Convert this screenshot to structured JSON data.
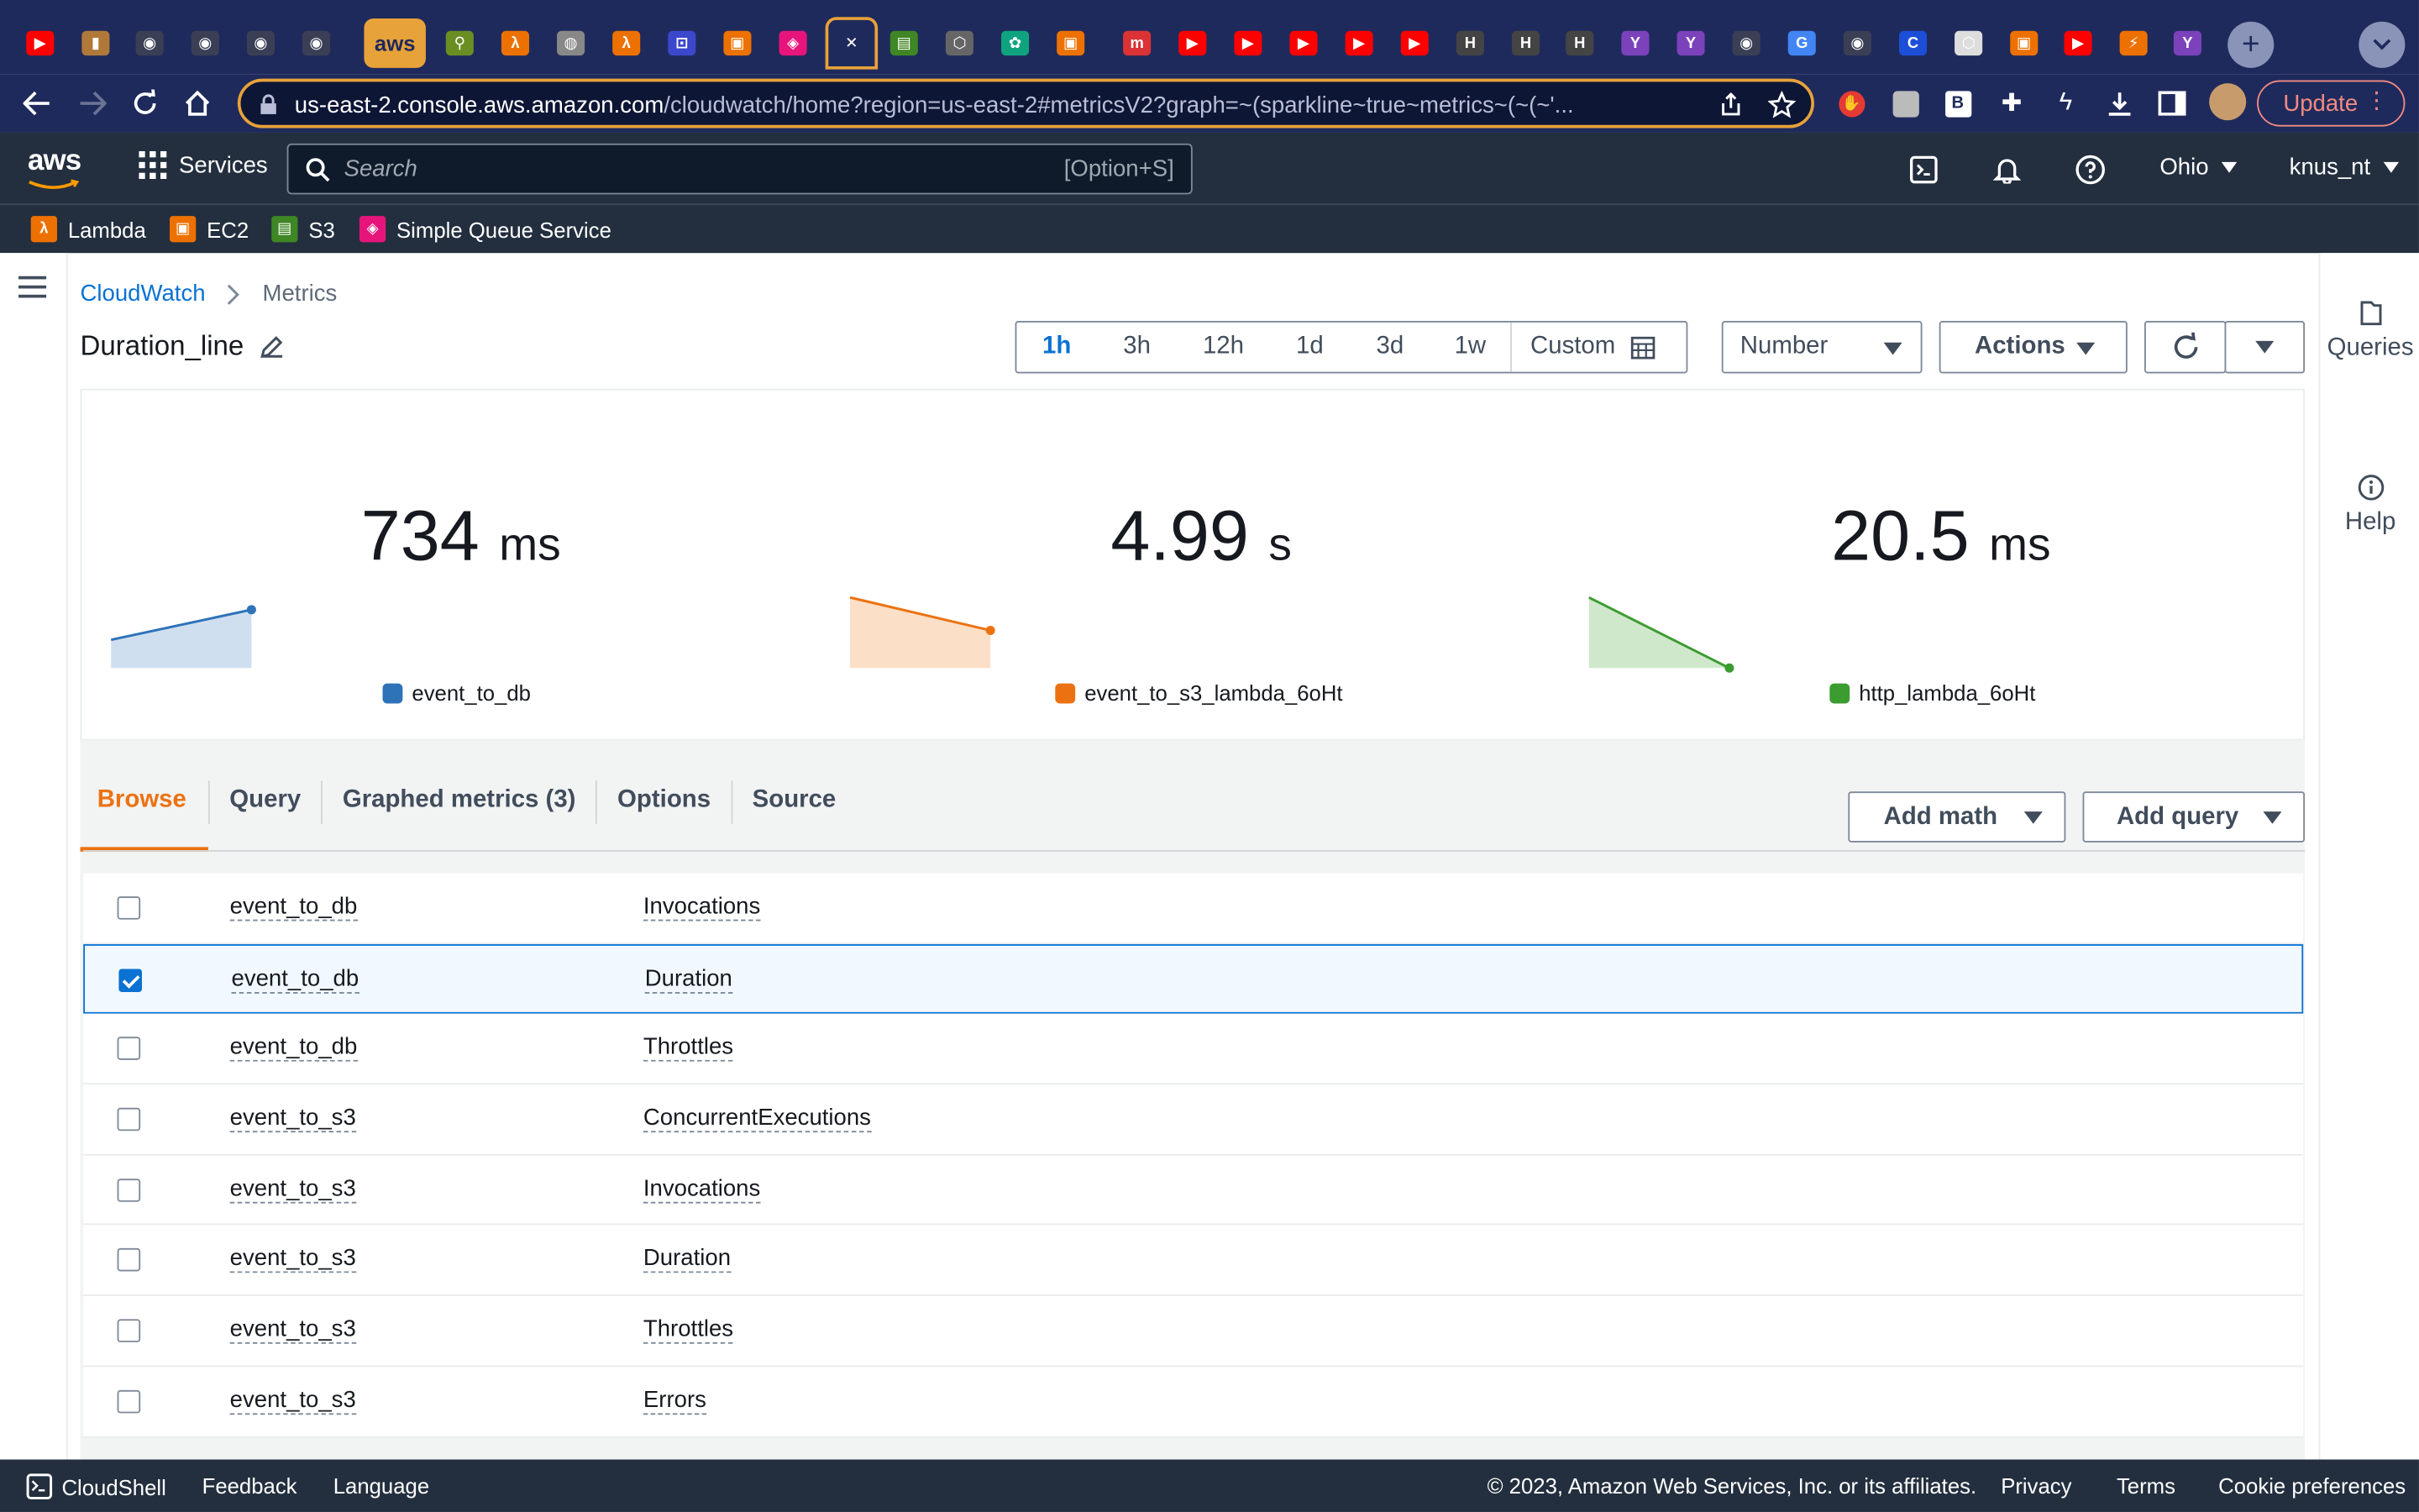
{
  "browser": {
    "tabs": [
      {
        "icon": "youtube-icon",
        "color": "#ff0000",
        "glyph": "▶"
      },
      {
        "icon": "folder-icon",
        "color": "#b0793a",
        "glyph": "▮"
      },
      {
        "icon": "github-icon",
        "color": "#3a3f55",
        "glyph": "◉"
      },
      {
        "icon": "github-icon",
        "color": "#3a3f55",
        "glyph": "◉"
      },
      {
        "icon": "github-icon",
        "color": "#3a3f55",
        "glyph": "◉"
      },
      {
        "icon": "github-icon",
        "color": "#3a3f55",
        "glyph": "◉"
      },
      {
        "icon": "aws-icon",
        "color": "#e8a23a",
        "glyph": "aws"
      },
      {
        "icon": "tool-icon",
        "color": "#6b8e23",
        "glyph": "⚲"
      },
      {
        "icon": "lambda-icon",
        "color": "#ed7100",
        "glyph": "λ"
      },
      {
        "icon": "globe-icon",
        "color": "#888",
        "glyph": "◍"
      },
      {
        "icon": "lambda-icon",
        "color": "#ed7100",
        "glyph": "λ"
      },
      {
        "icon": "cloudwatch-icon",
        "color": "#3b48cc",
        "glyph": "⊡"
      },
      {
        "icon": "box-icon",
        "color": "#ed7100",
        "glyph": "▣"
      },
      {
        "icon": "sqs-icon",
        "color": "#e7157b",
        "glyph": "◈"
      },
      {
        "icon": "close-icon",
        "color": "#1f2a5c",
        "glyph": "✕"
      },
      {
        "icon": "s3-icon",
        "color": "#3f8624",
        "glyph": "▤"
      },
      {
        "icon": "cube-icon",
        "color": "#666",
        "glyph": "⬡"
      },
      {
        "icon": "openai-icon",
        "color": "#10a37f",
        "glyph": "✿"
      },
      {
        "icon": "box-icon",
        "color": "#ed7100",
        "glyph": "▣"
      },
      {
        "icon": "m-icon",
        "color": "#db3236",
        "glyph": "m"
      },
      {
        "icon": "youtube-icon",
        "color": "#ff0000",
        "glyph": "▶"
      },
      {
        "icon": "youtube-icon",
        "color": "#ff0000",
        "glyph": "▶"
      },
      {
        "icon": "youtube-icon",
        "color": "#ff0000",
        "glyph": "▶"
      },
      {
        "icon": "youtube-icon",
        "color": "#ff0000",
        "glyph": "▶"
      },
      {
        "icon": "youtube-icon",
        "color": "#ff0000",
        "glyph": "▶"
      },
      {
        "icon": "hashicorp-icon",
        "color": "#444",
        "glyph": "H"
      },
      {
        "icon": "hashicorp-icon",
        "color": "#444",
        "glyph": "H"
      },
      {
        "icon": "hashicorp-icon",
        "color": "#444",
        "glyph": "H"
      },
      {
        "icon": "terraform-icon",
        "color": "#7b42bc",
        "glyph": "Y"
      },
      {
        "icon": "terraform-icon",
        "color": "#7b42bc",
        "glyph": "Y"
      },
      {
        "icon": "github-icon",
        "color": "#3a3f55",
        "glyph": "◉"
      },
      {
        "icon": "translate-icon",
        "color": "#4285f4",
        "glyph": "G"
      },
      {
        "icon": "github-icon",
        "color": "#3a3f55",
        "glyph": "◉"
      },
      {
        "icon": "c-icon",
        "color": "#1d4ed8",
        "glyph": "C"
      },
      {
        "icon": "cube-icon",
        "color": "#ddd",
        "glyph": "⬡"
      },
      {
        "icon": "box-icon",
        "color": "#ed7100",
        "glyph": "▣"
      },
      {
        "icon": "youtube-icon",
        "color": "#ff0000",
        "glyph": "▶"
      },
      {
        "icon": "lambda-icon",
        "color": "#ed7100",
        "glyph": "⚡"
      },
      {
        "icon": "terraform-icon",
        "color": "#7b42bc",
        "glyph": "Y"
      }
    ],
    "url_host": "us-east-2.console.aws.amazon.com",
    "url_path": "/cloudwatch/home?region=us-east-2#metricsV2?graph=~(sparkline~true~metrics~(~(~'...",
    "update_label": "Update"
  },
  "aws_header": {
    "logo": "aws",
    "services_label": "Services",
    "search_placeholder": "Search",
    "search_shortcut": "[Option+S]",
    "region": "Ohio",
    "account": "knus_nt"
  },
  "favorites": [
    {
      "label": "Lambda",
      "color": "#ed7100",
      "glyph": "λ"
    },
    {
      "label": "EC2",
      "color": "#ed7100",
      "glyph": "▣"
    },
    {
      "label": "S3",
      "color": "#3f8624",
      "glyph": "▤"
    },
    {
      "label": "Simple Queue Service",
      "color": "#e7157b",
      "glyph": "◈"
    }
  ],
  "breadcrumb": {
    "root": "CloudWatch",
    "current": "Metrics"
  },
  "graph": {
    "title": "Duration_line",
    "time_ranges": [
      "1h",
      "3h",
      "12h",
      "1d",
      "3d",
      "1w"
    ],
    "selected_range": "1h",
    "custom_label": "Custom",
    "view_type": "Number",
    "actions_label": "Actions"
  },
  "right_rail": {
    "queries": "Queries",
    "help": "Help"
  },
  "sparklines": [
    {
      "value": "734",
      "unit": "ms",
      "name": "event_to_db",
      "color": "#2e73b8",
      "fill": "#cfdff0",
      "trend": [
        0.3,
        0.62
      ]
    },
    {
      "value": "4.99",
      "unit": "s",
      "name": "event_to_s3_lambda_6oHt",
      "color": "#ec7211",
      "fill": "#fbdfc6",
      "trend": [
        0.75,
        0.4
      ]
    },
    {
      "value": "20.5",
      "unit": "ms",
      "name": "http_lambda_6oHt",
      "color": "#3b9c2f",
      "fill": "#cfe8cc",
      "trend": [
        0.75,
        0.0
      ]
    }
  ],
  "tabs": [
    "Browse",
    "Query",
    "Graphed metrics (3)",
    "Options",
    "Source"
  ],
  "selected_tab": "Browse",
  "add_math_label": "Add math",
  "add_query_label": "Add query",
  "rows": [
    {
      "function": "event_to_db",
      "metric": "Invocations",
      "checked": false
    },
    {
      "function": "event_to_db",
      "metric": "Duration",
      "checked": true
    },
    {
      "function": "event_to_db",
      "metric": "Throttles",
      "checked": false
    },
    {
      "function": "event_to_s3",
      "metric": "ConcurrentExecutions",
      "checked": false
    },
    {
      "function": "event_to_s3",
      "metric": "Invocations",
      "checked": false
    },
    {
      "function": "event_to_s3",
      "metric": "Duration",
      "checked": false
    },
    {
      "function": "event_to_s3",
      "metric": "Throttles",
      "checked": false
    },
    {
      "function": "event_to_s3",
      "metric": "Errors",
      "checked": false
    }
  ],
  "footer": {
    "cloudshell": "CloudShell",
    "feedback": "Feedback",
    "language": "Language",
    "copyright": "© 2023, Amazon Web Services, Inc. or its affiliates.",
    "privacy": "Privacy",
    "terms": "Terms",
    "cookies": "Cookie preferences"
  }
}
